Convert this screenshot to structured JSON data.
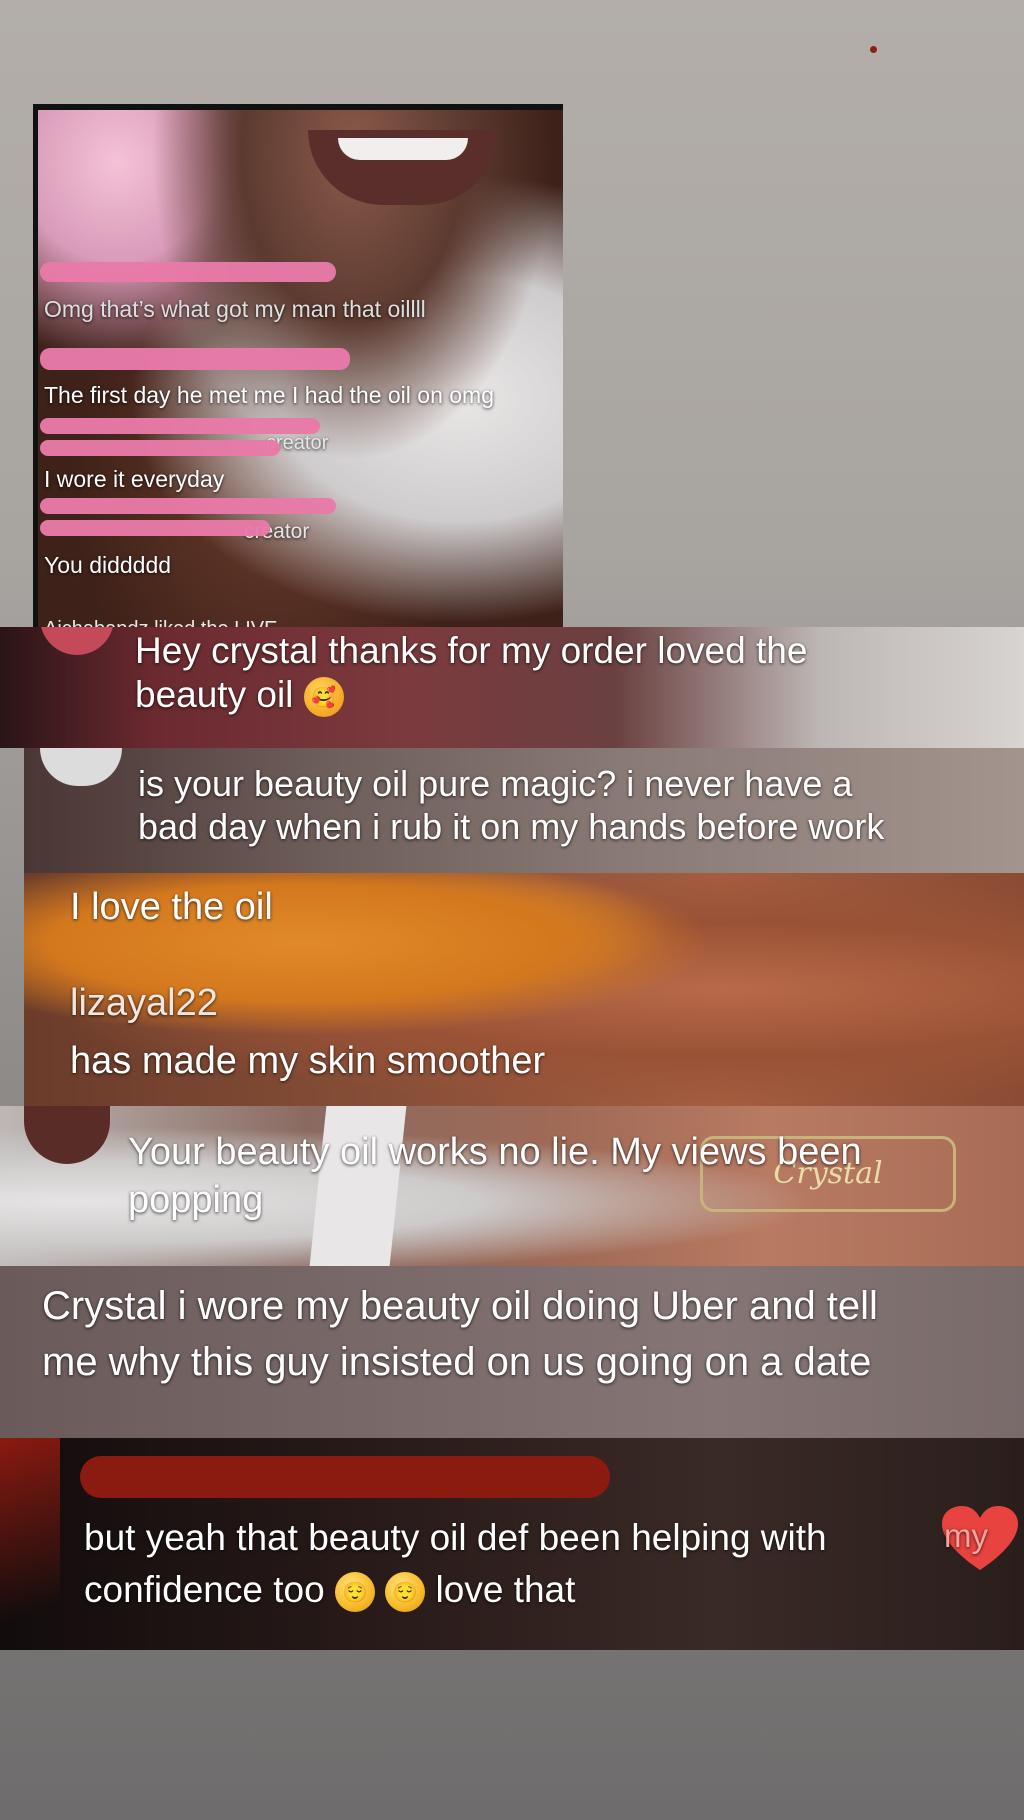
{
  "card1": {
    "comments": [
      {
        "text": "Omg that’s what got my man that oillll"
      },
      {
        "text": "The first day he met me I had the oil on omg"
      },
      {
        "text": "I wore it everyday"
      },
      {
        "text": "You diddddd"
      }
    ],
    "faint_labels": [
      "creator",
      "creator"
    ],
    "footer": "Aichabandz  liked the LIVE"
  },
  "panel1": {
    "line1": "Hey crystal thanks for my order loved the",
    "line2": "beauty oil",
    "emoji": "🥰"
  },
  "panel2": {
    "line1": "is your beauty oil pure magic? i never have a",
    "line2": "bad day when i rub it on my hands before work"
  },
  "panel3": {
    "comment1": "I love the oil",
    "username": "lizayal22",
    "comment2": "has made my skin smoother"
  },
  "panel4": {
    "line1": "Your beauty oil works no lie. My views been",
    "line2": "popping",
    "necklace_text": "Crystal"
  },
  "panel5": {
    "line1": "Crystal i wore my beauty oil doing Uber and tell",
    "line2": "me why this guy insisted on us going on a date"
  },
  "panel6": {
    "line1": "but yeah that beauty oil def been helping with",
    "line1_end": "my",
    "line2": "confidence too",
    "line2_end": "love that",
    "emoji": "😌"
  },
  "colors": {
    "redaction_pink": "#e87aa8",
    "redaction_red": "#8b1a10",
    "heart": "#e8433e"
  },
  "icons": [
    "heart-icon",
    "smiling-face-with-hearts-emoji",
    "relieved-face-emoji"
  ]
}
